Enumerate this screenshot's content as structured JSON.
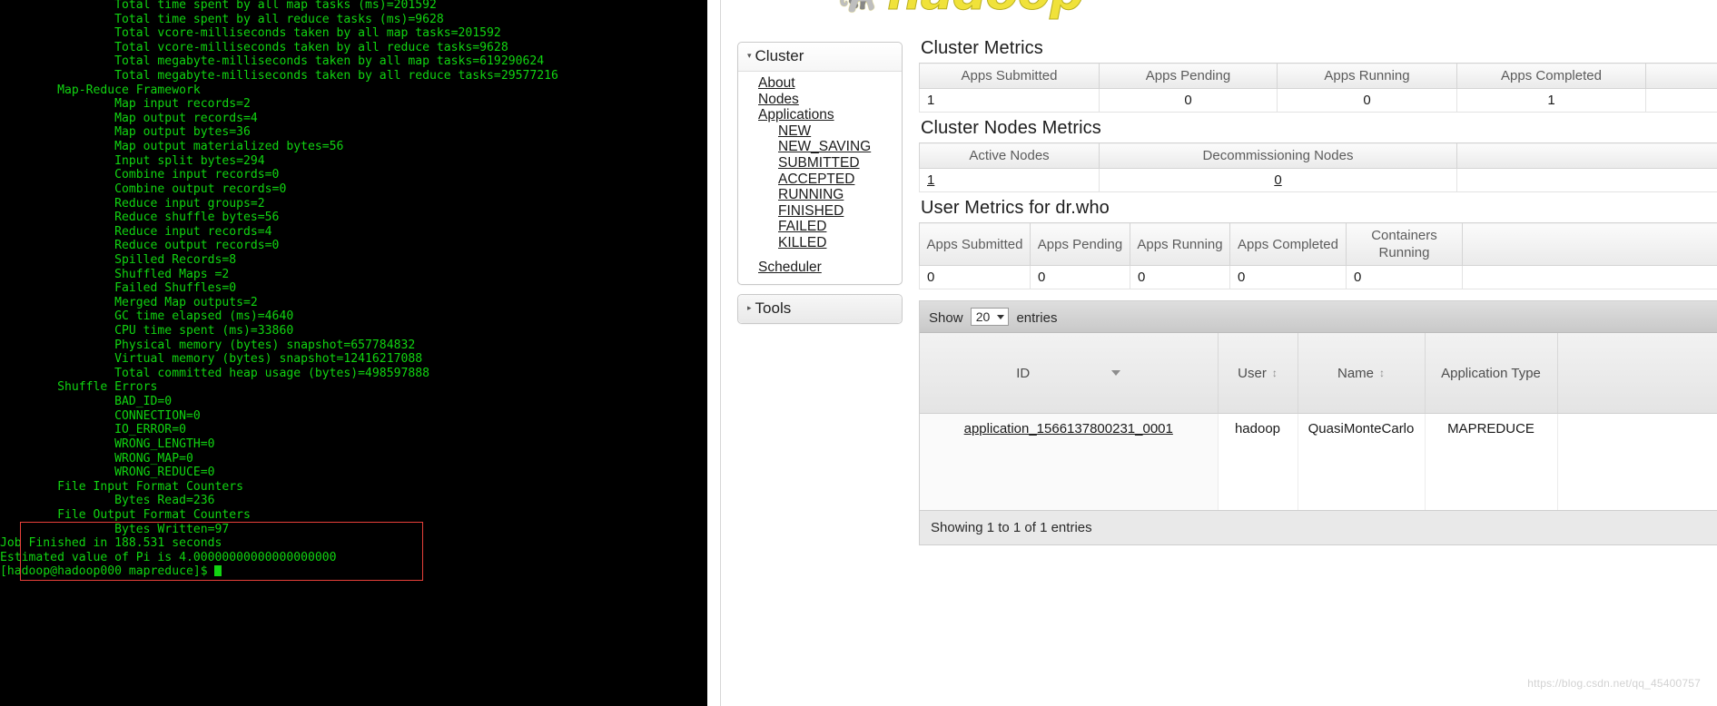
{
  "terminal": {
    "lines": [
      "                Total time spent by all map tasks (ms)=201592",
      "                Total time spent by all reduce tasks (ms)=9628",
      "                Total vcore-milliseconds taken by all map tasks=201592",
      "                Total vcore-milliseconds taken by all reduce tasks=9628",
      "                Total megabyte-milliseconds taken by all map tasks=619290624",
      "                Total megabyte-milliseconds taken by all reduce tasks=29577216",
      "        Map-Reduce Framework",
      "                Map input records=2",
      "                Map output records=4",
      "                Map output bytes=36",
      "                Map output materialized bytes=56",
      "                Input split bytes=294",
      "                Combine input records=0",
      "                Combine output records=0",
      "                Reduce input groups=2",
      "                Reduce shuffle bytes=56",
      "                Reduce input records=4",
      "                Reduce output records=0",
      "                Spilled Records=8",
      "                Shuffled Maps =2",
      "                Failed Shuffles=0",
      "                Merged Map outputs=2",
      "                GC time elapsed (ms)=4640",
      "                CPU time spent (ms)=33860",
      "                Physical memory (bytes) snapshot=657784832",
      "                Virtual memory (bytes) snapshot=12416217088",
      "                Total committed heap usage (bytes)=498597888",
      "        Shuffle Errors",
      "                BAD_ID=0",
      "                CONNECTION=0",
      "                IO_ERROR=0",
      "                WRONG_LENGTH=0",
      "                WRONG_MAP=0",
      "                WRONG_REDUCE=0",
      "        File Input Format Counters ",
      "                Bytes Read=236",
      "        File Output Format Counters ",
      "                Bytes Written=97",
      "Job Finished in 188.531 seconds",
      "Estimated value of Pi is 4.00000000000000000000"
    ],
    "prompt": "[hadoop@hadoop000 mapreduce]$"
  },
  "branding": {
    "logo_icon": "hadoop-elephant-icon",
    "wordmark": "hadoop"
  },
  "sidebar": {
    "cluster_panel": {
      "title": "Cluster",
      "expanded_marker": "▾",
      "links": [
        {
          "label": "About",
          "indent": 0
        },
        {
          "label": "Nodes",
          "indent": 0
        },
        {
          "label": "Applications",
          "indent": 0
        },
        {
          "label": "NEW",
          "indent": 1
        },
        {
          "label": "NEW_SAVING",
          "indent": 1
        },
        {
          "label": "SUBMITTED",
          "indent": 1
        },
        {
          "label": "ACCEPTED",
          "indent": 1
        },
        {
          "label": "RUNNING",
          "indent": 1
        },
        {
          "label": "FINISHED",
          "indent": 1
        },
        {
          "label": "FAILED",
          "indent": 1
        },
        {
          "label": "KILLED",
          "indent": 1
        },
        {
          "label": "Scheduler",
          "indent": 0
        }
      ]
    },
    "tools_panel": {
      "title": "Tools",
      "collapsed_marker": "▸"
    }
  },
  "main": {
    "cluster_metrics": {
      "title": "Cluster Metrics",
      "headers": [
        "Apps Submitted",
        "Apps Pending",
        "Apps Running",
        "Apps Completed"
      ],
      "values": [
        "1",
        "0",
        "0",
        "1"
      ]
    },
    "cluster_nodes_metrics": {
      "title": "Cluster Nodes Metrics",
      "headers": [
        "Active Nodes",
        "Decommissioning Nodes"
      ],
      "values": [
        "1",
        "0"
      ]
    },
    "user_metrics": {
      "title": "User Metrics for dr.who",
      "headers": [
        "Apps Submitted",
        "Apps Pending",
        "Apps Running",
        "Apps Completed",
        "Containers Running"
      ],
      "values": [
        "0",
        "0",
        "0",
        "0",
        "0"
      ]
    },
    "applications_table": {
      "show_label": "Show",
      "entries_label": "entries",
      "page_size": "20",
      "columns": [
        {
          "label": "ID",
          "sort": "desc"
        },
        {
          "label": "User",
          "sort": "both"
        },
        {
          "label": "Name",
          "sort": "both"
        },
        {
          "label": "Application Type",
          "sort": "none"
        }
      ],
      "rows": [
        {
          "id": "application_1566137800231_0001",
          "user": "hadoop",
          "name": "QuasiMonteCarlo",
          "app_type": "MAPREDUCE"
        }
      ],
      "footer": "Showing 1 to 1 of 1 entries"
    }
  },
  "annotations": {
    "highlight_color": "#e8403a",
    "terminal_box_label": "job-result-highlight",
    "ui_box_label": "apps-metrics-highlight"
  },
  "watermark": "https://blog.csdn.net/qq_45400757"
}
